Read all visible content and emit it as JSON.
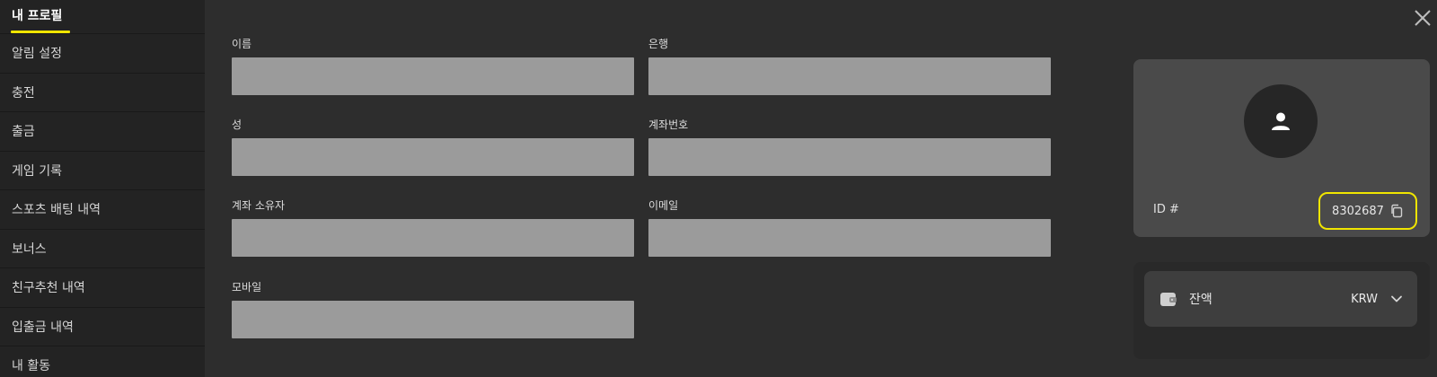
{
  "sidebar": {
    "items": [
      {
        "label": "내 프로필",
        "active": true
      },
      {
        "label": "알림 설정"
      },
      {
        "label": "충전"
      },
      {
        "label": "출금"
      },
      {
        "label": "게임 기록"
      },
      {
        "label": "스포츠 배팅 내역"
      },
      {
        "label": "보너스"
      },
      {
        "label": "친구추천 내역"
      },
      {
        "label": "입출금 내역"
      },
      {
        "label": "내 활동"
      }
    ]
  },
  "form": {
    "first_name_label": "이름",
    "bank_label": "은행",
    "last_name_label": "성",
    "account_number_label": "계좌번호",
    "account_holder_label": "계좌 소유자",
    "email_label": "이메일",
    "mobile_label": "모바일"
  },
  "profile": {
    "id_label": "ID #",
    "id_value": "8302687",
    "highlight_color": "#f0e500"
  },
  "balance": {
    "label": "잔액",
    "currency": "KRW"
  },
  "icons": {
    "close": "close-icon",
    "avatar": "user-icon",
    "copy": "copy-icon",
    "wallet": "wallet-icon",
    "chevron": "chevron-down-icon"
  },
  "colors": {
    "accent": "#f0e500",
    "input_bg": "#9b9b9b",
    "sidebar_bg": "#232323",
    "main_bg": "#2d2d2d"
  }
}
